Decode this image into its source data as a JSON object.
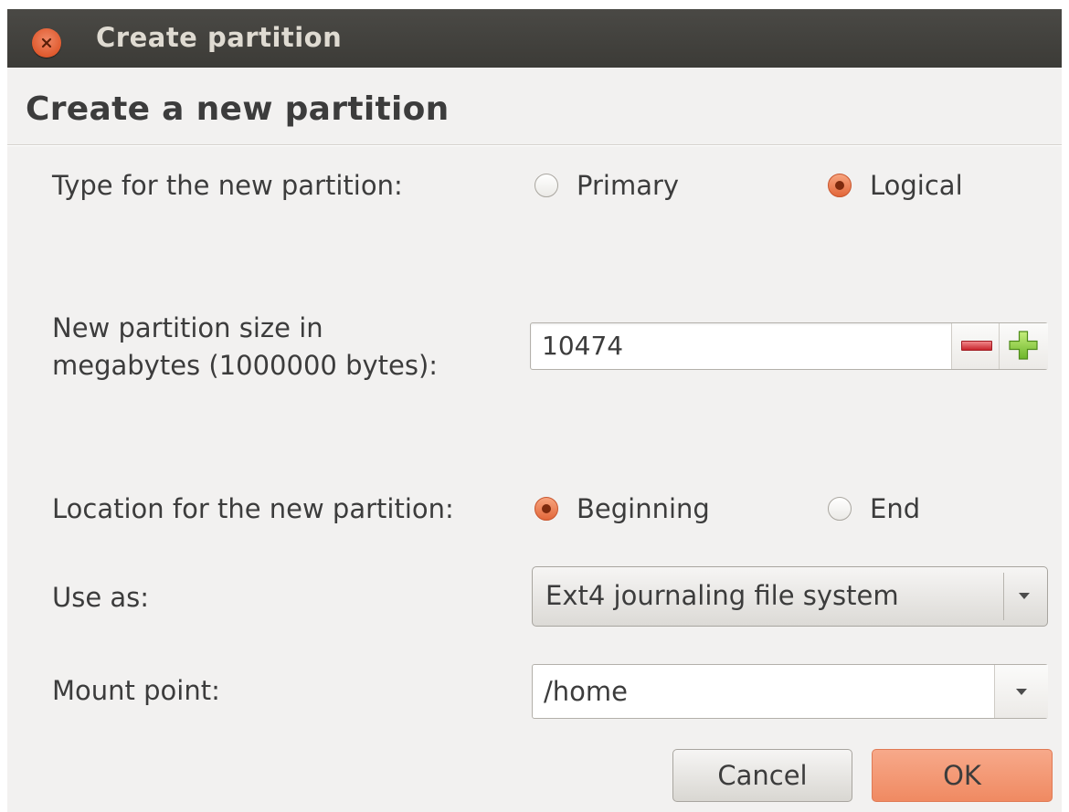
{
  "window": {
    "title": "Create partition",
    "heading": "Create a new partition"
  },
  "type": {
    "label": "Type for the new partition:",
    "options": [
      {
        "label": "Primary",
        "selected": false
      },
      {
        "label": "Logical",
        "selected": true
      }
    ]
  },
  "size": {
    "label_line1": "New partition size in",
    "label_line2": "megabytes (1000000 bytes):",
    "value": "10474"
  },
  "location": {
    "label": "Location for the new partition:",
    "options": [
      {
        "label": "Beginning",
        "selected": true
      },
      {
        "label": "End",
        "selected": false
      }
    ]
  },
  "use_as": {
    "label": "Use as:",
    "value": "Ext4 journaling file system"
  },
  "mount": {
    "label": "Mount point:",
    "value": "/home"
  },
  "buttons": {
    "cancel": "Cancel",
    "ok": "OK"
  },
  "colors": {
    "accent": "#e2673a",
    "titlebar": "#3c3b37",
    "ok_button": "#f08a62"
  },
  "icons": {
    "close": "close-icon",
    "minus": "minus-icon",
    "plus": "plus-icon",
    "dropdown": "chevron-down-icon"
  }
}
